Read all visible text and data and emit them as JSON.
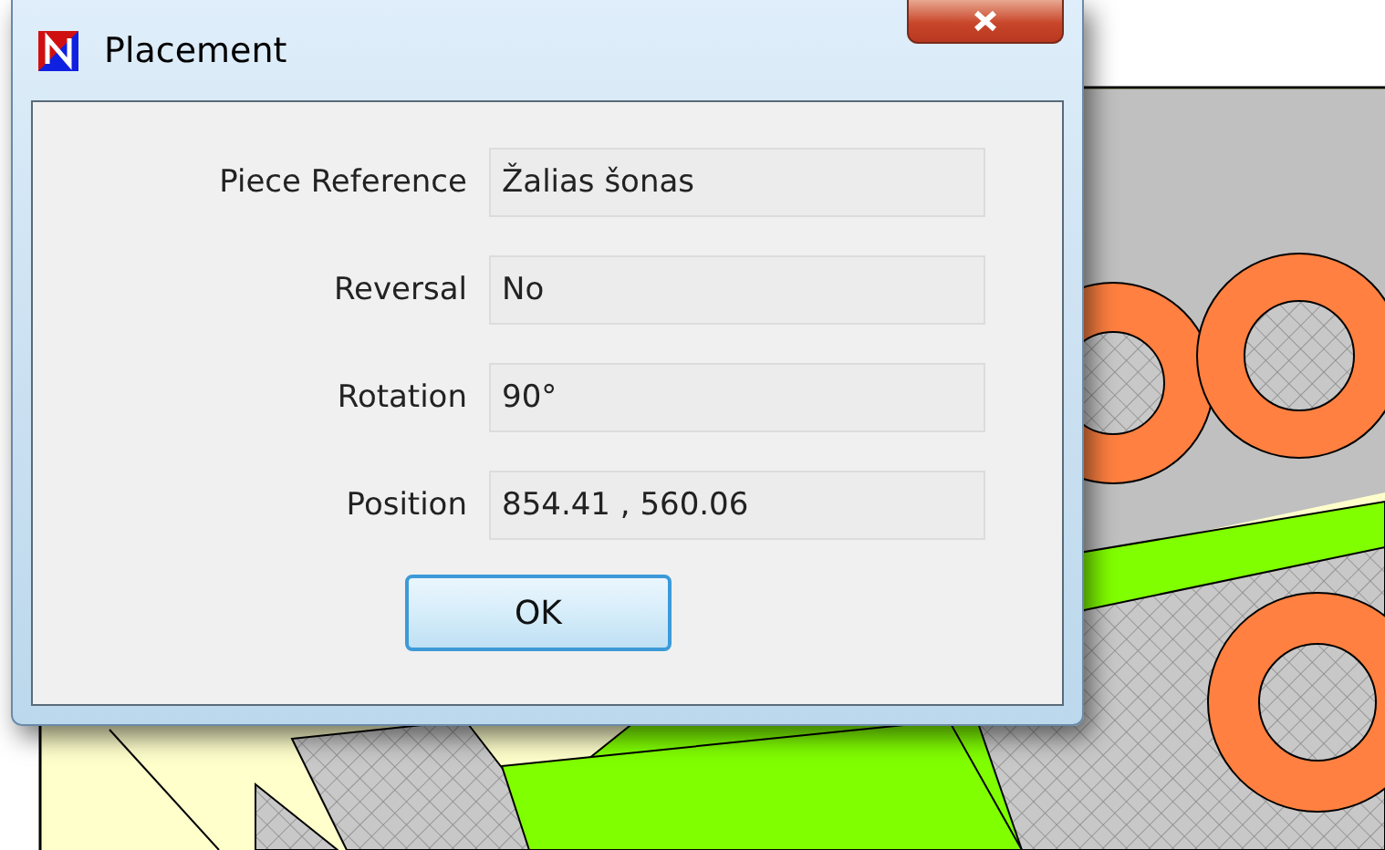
{
  "window": {
    "title": "Placement"
  },
  "fields": [
    {
      "label": "Piece Reference",
      "value": "Žalias šonas"
    },
    {
      "label": "Reversal",
      "value": "No"
    },
    {
      "label": "Rotation",
      "value": "90°"
    },
    {
      "label": "Position",
      "value": "854.41 , 560.06"
    }
  ],
  "buttons": [
    "OK"
  ]
}
